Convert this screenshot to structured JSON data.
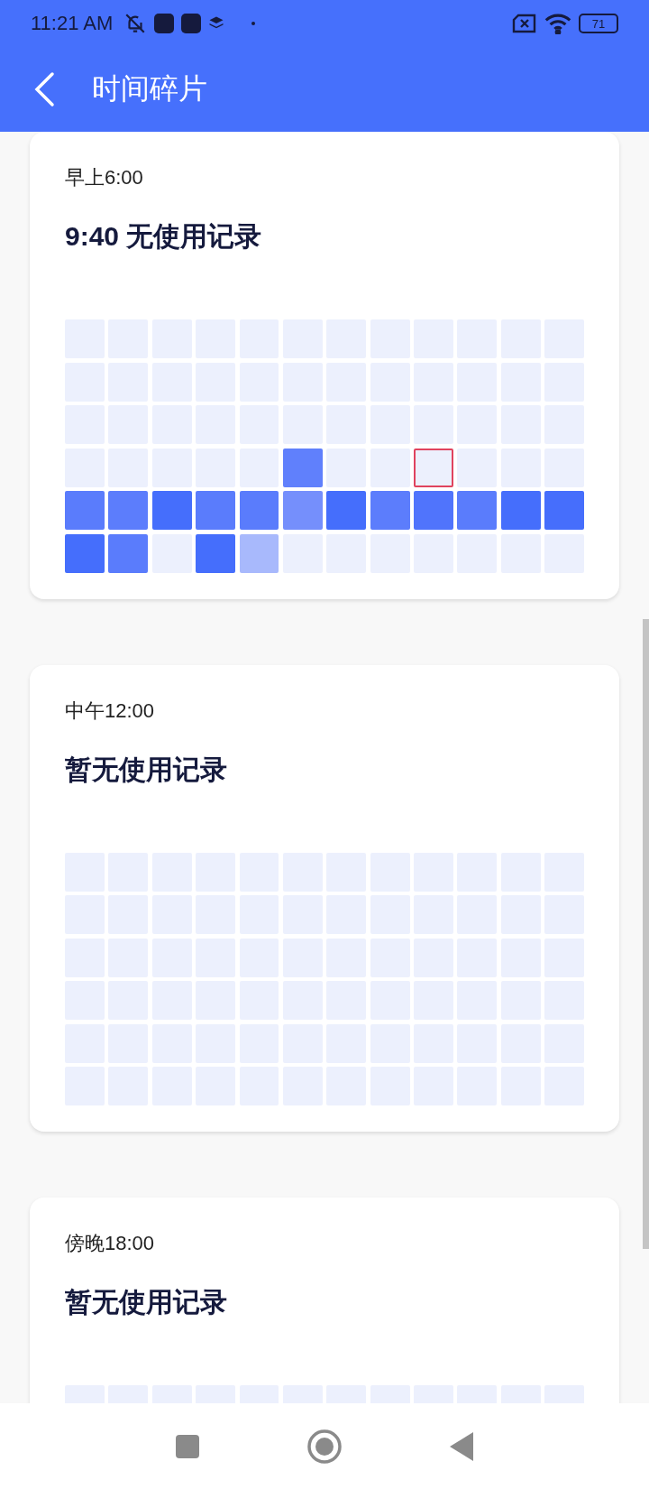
{
  "status_bar": {
    "time": "11:21 AM",
    "battery": "71"
  },
  "app_bar": {
    "title": "时间碎片"
  },
  "cards": [
    {
      "label": "早上6:00",
      "title": "9:40 无使用记录",
      "rows": [
        [
          {
            "color": "#ecf0fd",
            "selected": false
          },
          {
            "color": "#ecf0fd",
            "selected": false
          },
          {
            "color": "#ecf0fd",
            "selected": false
          },
          {
            "color": "#ecf0fd",
            "selected": false
          },
          {
            "color": "#ecf0fd",
            "selected": false
          },
          {
            "color": "#ecf0fd",
            "selected": false
          },
          {
            "color": "#ecf0fd",
            "selected": false
          },
          {
            "color": "#ecf0fd",
            "selected": false
          },
          {
            "color": "#ecf0fd",
            "selected": false
          },
          {
            "color": "#ecf0fd",
            "selected": false
          },
          {
            "color": "#ecf0fd",
            "selected": false
          },
          {
            "color": "#ecf0fd",
            "selected": false
          }
        ],
        [
          {
            "color": "#ecf0fd",
            "selected": false
          },
          {
            "color": "#ecf0fd",
            "selected": false
          },
          {
            "color": "#ecf0fd",
            "selected": false
          },
          {
            "color": "#ecf0fd",
            "selected": false
          },
          {
            "color": "#ecf0fd",
            "selected": false
          },
          {
            "color": "#ecf0fd",
            "selected": false
          },
          {
            "color": "#ecf0fd",
            "selected": false
          },
          {
            "color": "#ecf0fd",
            "selected": false
          },
          {
            "color": "#ecf0fd",
            "selected": false
          },
          {
            "color": "#ecf0fd",
            "selected": false
          },
          {
            "color": "#ecf0fd",
            "selected": false
          },
          {
            "color": "#ecf0fd",
            "selected": false
          }
        ],
        [
          {
            "color": "#ecf0fd",
            "selected": false
          },
          {
            "color": "#ecf0fd",
            "selected": false
          },
          {
            "color": "#ecf0fd",
            "selected": false
          },
          {
            "color": "#ecf0fd",
            "selected": false
          },
          {
            "color": "#ecf0fd",
            "selected": false
          },
          {
            "color": "#ecf0fd",
            "selected": false
          },
          {
            "color": "#ecf0fd",
            "selected": false
          },
          {
            "color": "#ecf0fd",
            "selected": false
          },
          {
            "color": "#ecf0fd",
            "selected": false
          },
          {
            "color": "#ecf0fd",
            "selected": false
          },
          {
            "color": "#ecf0fd",
            "selected": false
          },
          {
            "color": "#ecf0fd",
            "selected": false
          }
        ],
        [
          {
            "color": "#ecf0fd",
            "selected": false
          },
          {
            "color": "#ecf0fd",
            "selected": false
          },
          {
            "color": "#ecf0fd",
            "selected": false
          },
          {
            "color": "#ecf0fd",
            "selected": false
          },
          {
            "color": "#ecf0fd",
            "selected": false
          },
          {
            "color": "#6080fc",
            "selected": false
          },
          {
            "color": "#ecf0fd",
            "selected": false
          },
          {
            "color": "#ecf0fd",
            "selected": false
          },
          {
            "color": "#ecf0fd",
            "selected": true
          },
          {
            "color": "#ecf0fd",
            "selected": false
          },
          {
            "color": "#ecf0fd",
            "selected": false
          },
          {
            "color": "#ecf0fd",
            "selected": false
          }
        ],
        [
          {
            "color": "#5a7cfc",
            "selected": false
          },
          {
            "color": "#5c7dfc",
            "selected": false
          },
          {
            "color": "#456efc",
            "selected": false
          },
          {
            "color": "#5a7cfc",
            "selected": false
          },
          {
            "color": "#5a7cfc",
            "selected": false
          },
          {
            "color": "#758ffc",
            "selected": false
          },
          {
            "color": "#456efc",
            "selected": false
          },
          {
            "color": "#5c7dfc",
            "selected": false
          },
          {
            "color": "#5074fc",
            "selected": false
          },
          {
            "color": "#5a7cfc",
            "selected": false
          },
          {
            "color": "#456efc",
            "selected": false
          },
          {
            "color": "#466efc",
            "selected": false
          }
        ],
        [
          {
            "color": "#456efc",
            "selected": false
          },
          {
            "color": "#5a7cfc",
            "selected": false
          },
          {
            "color": "#ecf0fd",
            "selected": false
          },
          {
            "color": "#456efc",
            "selected": false
          },
          {
            "color": "#a8b9fc",
            "selected": false
          },
          {
            "color": "#ecf0fd",
            "selected": false
          },
          {
            "color": "#ecf0fd",
            "selected": false
          },
          {
            "color": "#ecf0fd",
            "selected": false
          },
          {
            "color": "#ecf0fd",
            "selected": false
          },
          {
            "color": "#ecf0fd",
            "selected": false
          },
          {
            "color": "#ecf0fd",
            "selected": false
          },
          {
            "color": "#ecf0fd",
            "selected": false
          }
        ]
      ]
    },
    {
      "label": "中午12:00",
      "title": "暂无使用记录",
      "rows": [
        [
          {
            "color": "#ecf0fd",
            "selected": false
          },
          {
            "color": "#ecf0fd",
            "selected": false
          },
          {
            "color": "#ecf0fd",
            "selected": false
          },
          {
            "color": "#ecf0fd",
            "selected": false
          },
          {
            "color": "#ecf0fd",
            "selected": false
          },
          {
            "color": "#ecf0fd",
            "selected": false
          },
          {
            "color": "#ecf0fd",
            "selected": false
          },
          {
            "color": "#ecf0fd",
            "selected": false
          },
          {
            "color": "#ecf0fd",
            "selected": false
          },
          {
            "color": "#ecf0fd",
            "selected": false
          },
          {
            "color": "#ecf0fd",
            "selected": false
          },
          {
            "color": "#ecf0fd",
            "selected": false
          }
        ],
        [
          {
            "color": "#ecf0fd",
            "selected": false
          },
          {
            "color": "#ecf0fd",
            "selected": false
          },
          {
            "color": "#ecf0fd",
            "selected": false
          },
          {
            "color": "#ecf0fd",
            "selected": false
          },
          {
            "color": "#ecf0fd",
            "selected": false
          },
          {
            "color": "#ecf0fd",
            "selected": false
          },
          {
            "color": "#ecf0fd",
            "selected": false
          },
          {
            "color": "#ecf0fd",
            "selected": false
          },
          {
            "color": "#ecf0fd",
            "selected": false
          },
          {
            "color": "#ecf0fd",
            "selected": false
          },
          {
            "color": "#ecf0fd",
            "selected": false
          },
          {
            "color": "#ecf0fd",
            "selected": false
          }
        ],
        [
          {
            "color": "#ecf0fd",
            "selected": false
          },
          {
            "color": "#ecf0fd",
            "selected": false
          },
          {
            "color": "#ecf0fd",
            "selected": false
          },
          {
            "color": "#ecf0fd",
            "selected": false
          },
          {
            "color": "#ecf0fd",
            "selected": false
          },
          {
            "color": "#ecf0fd",
            "selected": false
          },
          {
            "color": "#ecf0fd",
            "selected": false
          },
          {
            "color": "#ecf0fd",
            "selected": false
          },
          {
            "color": "#ecf0fd",
            "selected": false
          },
          {
            "color": "#ecf0fd",
            "selected": false
          },
          {
            "color": "#ecf0fd",
            "selected": false
          },
          {
            "color": "#ecf0fd",
            "selected": false
          }
        ],
        [
          {
            "color": "#ecf0fd",
            "selected": false
          },
          {
            "color": "#ecf0fd",
            "selected": false
          },
          {
            "color": "#ecf0fd",
            "selected": false
          },
          {
            "color": "#ecf0fd",
            "selected": false
          },
          {
            "color": "#ecf0fd",
            "selected": false
          },
          {
            "color": "#ecf0fd",
            "selected": false
          },
          {
            "color": "#ecf0fd",
            "selected": false
          },
          {
            "color": "#ecf0fd",
            "selected": false
          },
          {
            "color": "#ecf0fd",
            "selected": false
          },
          {
            "color": "#ecf0fd",
            "selected": false
          },
          {
            "color": "#ecf0fd",
            "selected": false
          },
          {
            "color": "#ecf0fd",
            "selected": false
          }
        ],
        [
          {
            "color": "#ecf0fd",
            "selected": false
          },
          {
            "color": "#ecf0fd",
            "selected": false
          },
          {
            "color": "#ecf0fd",
            "selected": false
          },
          {
            "color": "#ecf0fd",
            "selected": false
          },
          {
            "color": "#ecf0fd",
            "selected": false
          },
          {
            "color": "#ecf0fd",
            "selected": false
          },
          {
            "color": "#ecf0fd",
            "selected": false
          },
          {
            "color": "#ecf0fd",
            "selected": false
          },
          {
            "color": "#ecf0fd",
            "selected": false
          },
          {
            "color": "#ecf0fd",
            "selected": false
          },
          {
            "color": "#ecf0fd",
            "selected": false
          },
          {
            "color": "#ecf0fd",
            "selected": false
          }
        ],
        [
          {
            "color": "#ecf0fd",
            "selected": false
          },
          {
            "color": "#ecf0fd",
            "selected": false
          },
          {
            "color": "#ecf0fd",
            "selected": false
          },
          {
            "color": "#ecf0fd",
            "selected": false
          },
          {
            "color": "#ecf0fd",
            "selected": false
          },
          {
            "color": "#ecf0fd",
            "selected": false
          },
          {
            "color": "#ecf0fd",
            "selected": false
          },
          {
            "color": "#ecf0fd",
            "selected": false
          },
          {
            "color": "#ecf0fd",
            "selected": false
          },
          {
            "color": "#ecf0fd",
            "selected": false
          },
          {
            "color": "#ecf0fd",
            "selected": false
          },
          {
            "color": "#ecf0fd",
            "selected": false
          }
        ]
      ]
    },
    {
      "label": "傍晚18:00",
      "title": "暂无使用记录",
      "rows": [
        [
          {
            "color": "#ecf0fd",
            "selected": false
          },
          {
            "color": "#ecf0fd",
            "selected": false
          },
          {
            "color": "#ecf0fd",
            "selected": false
          },
          {
            "color": "#ecf0fd",
            "selected": false
          },
          {
            "color": "#ecf0fd",
            "selected": false
          },
          {
            "color": "#ecf0fd",
            "selected": false
          },
          {
            "color": "#ecf0fd",
            "selected": false
          },
          {
            "color": "#ecf0fd",
            "selected": false
          },
          {
            "color": "#ecf0fd",
            "selected": false
          },
          {
            "color": "#ecf0fd",
            "selected": false
          },
          {
            "color": "#ecf0fd",
            "selected": false
          },
          {
            "color": "#ecf0fd",
            "selected": false
          }
        ]
      ]
    }
  ]
}
